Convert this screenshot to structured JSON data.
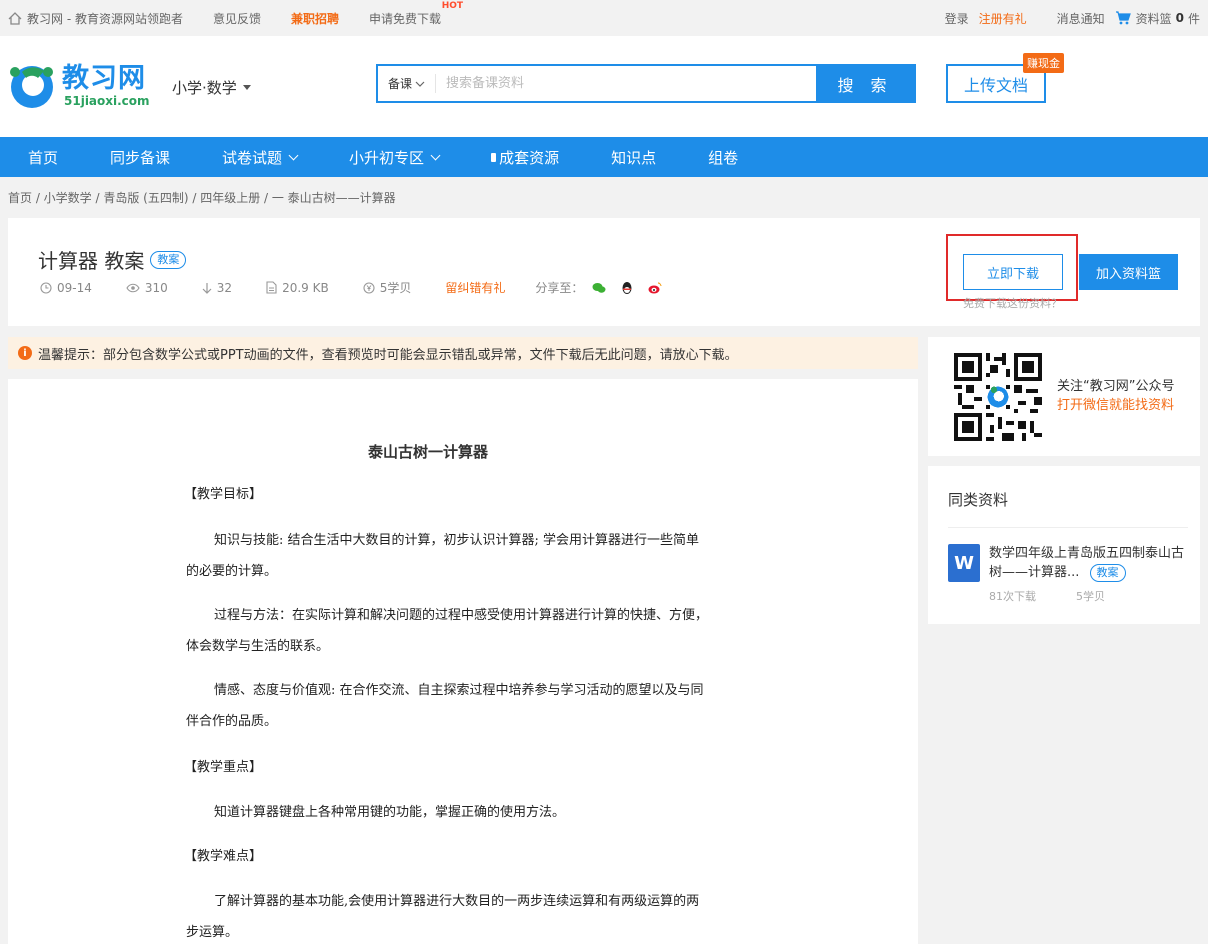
{
  "topbar": {
    "site_slogan": "教习网 - 教育资源网站领跑者",
    "feedback": "意见反馈",
    "jobs": "兼职招聘",
    "free_download": "申请免费下载",
    "hot": "HOT",
    "login": "登录",
    "register": "注册有礼",
    "messages": "消息通知",
    "basket_label": "资料篮",
    "basket_count": "0",
    "basket_unit": "件"
  },
  "header": {
    "logo_cn": "教习网",
    "logo_en": "51jiaoxi.com",
    "subject": "小学·数学",
    "search_type": "备课",
    "search_placeholder": "搜索备课资料",
    "search_button": "搜 索",
    "upload": "上传文档",
    "earn_badge": "赚现金"
  },
  "nav": {
    "items": [
      "首页",
      "同步备课",
      "试卷试题",
      "小升初专区",
      "成套资源",
      "知识点",
      "组卷"
    ]
  },
  "breadcrumb": "首页 / 小学数学 / 青岛版 (五四制) / 四年级上册 / 一 泰山古树——计算器",
  "resource": {
    "title": "计算器 教案",
    "tag": "教案",
    "date": "09-14",
    "views": "310",
    "downloads": "32",
    "size": "20.9 KB",
    "price": "5学贝",
    "report": "留纠错有礼",
    "share_label": "分享至：",
    "download_button": "立即下载",
    "basket_button": "加入资料篮",
    "free_note": "免费下载这份资料？"
  },
  "tip": "温馨提示：部分包含数学公式或PPT动画的文件，查看预览时可能会显示错乱或异常，文件下载后无此问题，请放心下载。",
  "document": {
    "title": "泰山古树一计算器",
    "h1": "【教学目标】",
    "p1a": "知识与技能: 结合生活中大数目的计算，初步认识计算器; 学会用计算器进行一些简单",
    "p1b": "的必要的计算。",
    "p2a": "过程与方法：在实际计算和解决问题的过程中感受使用计算器进行计算的快捷、方便，",
    "p2b": "体会数学与生活的联系。",
    "p3a": "情感、态度与价值观: 在合作交流、自主探索过程中培养参与学习活动的愿望以及与同",
    "p3b": "伴合作的品质。",
    "h2": "【教学重点】",
    "p4": "知道计算器键盘上各种常用键的功能，掌握正确的使用方法。",
    "h3": "【教学难点】",
    "p5a": "了解计算器的基本功能,会使用计算器进行大数目的一两步连续运算和有两级运算的两",
    "p5b": "步运算。"
  },
  "wechat": {
    "line1": "关注“教习网”公众号",
    "line2": "打开微信就能找资料"
  },
  "similar": {
    "heading": "同类资料",
    "icon": "W",
    "item_title": "数学四年级上青岛版五四制泰山古树——计算器...",
    "item_tag": "教案",
    "item_downloads": "81次下载",
    "item_price": "5学贝"
  }
}
